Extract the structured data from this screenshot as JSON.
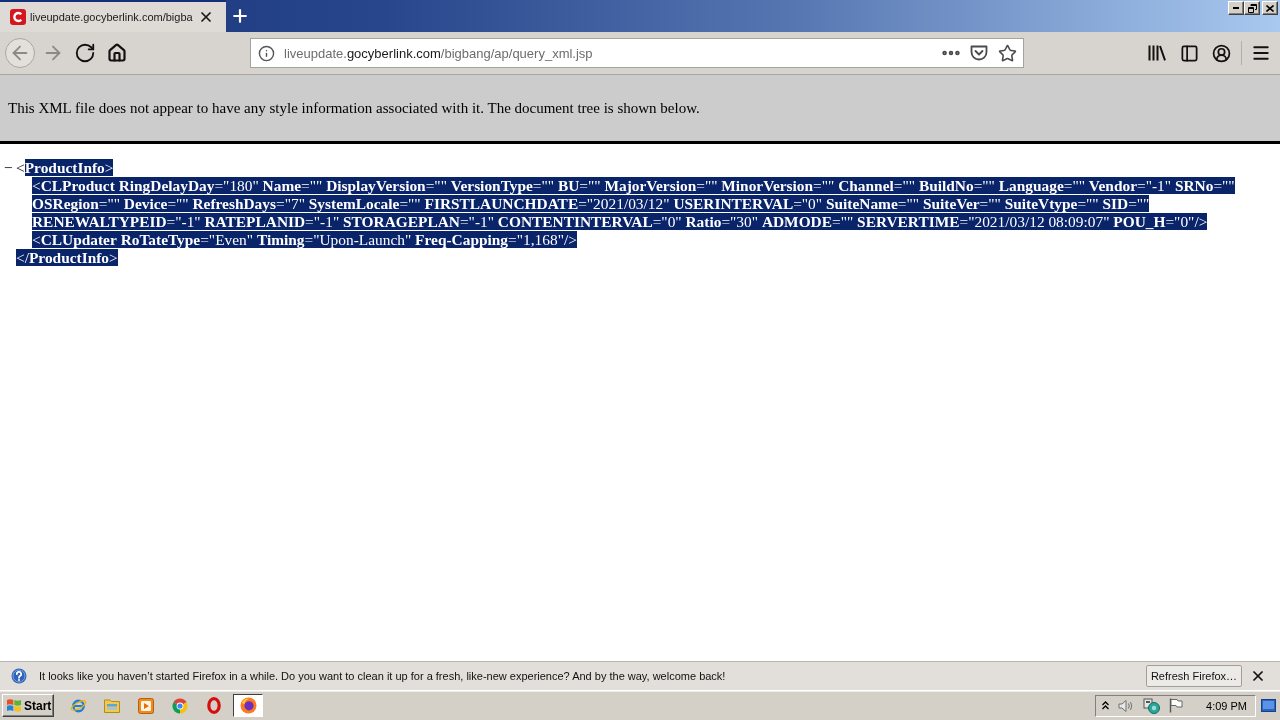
{
  "tabs": [
    {
      "title": "liveupdate.gocyberlink.com/bigba",
      "selected": true
    }
  ],
  "toolbar": {
    "nav": [
      {
        "kind": "back",
        "disabled": true
      },
      {
        "kind": "forward",
        "disabled": true
      },
      {
        "kind": "reload",
        "disabled": false
      },
      {
        "kind": "home",
        "disabled": false
      }
    ],
    "url": {
      "subdomain": "liveupdate.",
      "domain": "gocyberlink.com",
      "path": "/bigbang/ap/query_xml.jsp"
    }
  },
  "page": {
    "banner": "This XML file does not appear to have any style information associated with it. The document tree is shown below.",
    "tree": {
      "expander": "−",
      "expanded": true,
      "open_tag": [
        {
          "text": "<",
          "selected": false
        },
        {
          "text": "**ProductInfo**>",
          "selected": true
        }
      ],
      "children": [
        {
          "text": "<**CLProduct** **RingDelayDay**=\"180\" **Name**=\"\" **DisplayVersion**=\"\" **VersionType**=\"\" **BU**=\"\" **MajorVersion**=\"\" **MinorVersion**=\"\" **Channel**=\"\" **BuildNo**=\"\" **Language**=\"\" **Vendor**=\"-1\" **SRNo**=\"\" **OSRegion**=\"\" **Device**=\"\" **RefreshDays**=\"7\" **SystemLocale**=\"\" **FIRSTLAUNCHDATE**=\"2021/03/12\" **USERINTERVAL**=\"0\" **SuiteName**=\"\" **SuiteVer**=\"\" **SuiteVtype**=\"\" **SID**=\"\" **RENEWALTYPEID**=\"-1\" **RATEPLANID**=\"-1\" **STORAGEPLAN**=\"-1\" **CONTENTINTERVAL**=\"0\" **Ratio**=\"30\" **ADMODE**=\"\" **SERVERTIME**=\"2021/03/12 08:09:07\" **POU_H**=\"0\"/>",
          "selected": true
        },
        {
          "text": "<**CLUpdater** **RoTateType**=\"Even\" **Timing**=\"Upon-Launch\" **Freq-Capping**=\"1,168\"/>",
          "selected": true
        }
      ],
      "close_tag": {
        "text": "</**ProductInfo**>",
        "selected": true
      }
    }
  },
  "notification": {
    "message": "It looks like you haven’t started Firefox in a while. Do you want to clean it up for a fresh, like-new experience? And by the way, welcome back!",
    "button": "Refresh Firefox…"
  },
  "taskbar": {
    "start": "Start",
    "apps": [
      {
        "kind": "ie",
        "selected": false
      },
      {
        "kind": "folder",
        "selected": false
      },
      {
        "kind": "media",
        "selected": false
      },
      {
        "kind": "chrome",
        "selected": false
      },
      {
        "kind": "opera",
        "selected": false
      },
      {
        "kind": "firefox",
        "selected": true
      }
    ],
    "clock": "4:09 PM"
  }
}
